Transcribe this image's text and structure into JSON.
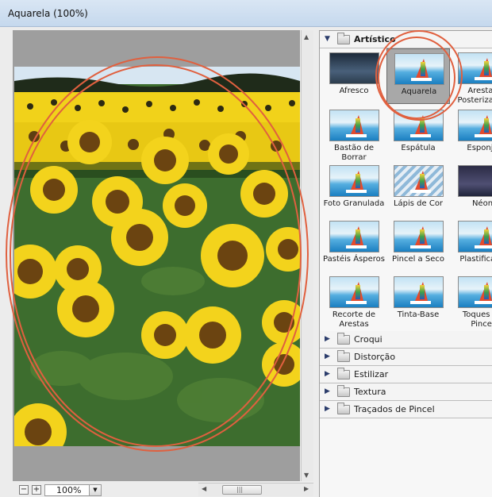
{
  "window": {
    "title": "Aquarela (100%)"
  },
  "zoom": {
    "minus": "−",
    "plus": "+",
    "value": "100%",
    "dropdown": "▼"
  },
  "scroll": {
    "up": "▲",
    "down": "▼",
    "left": "◀",
    "right": "▶",
    "grip": "|||"
  },
  "colors": {
    "annotation": "#e0603f",
    "selection": "#a8a8a8",
    "preview_bg": "#9e9e9e"
  },
  "gallery": {
    "open_category": "Artístico",
    "filters": [
      {
        "label": "Afresco",
        "style": "dark"
      },
      {
        "label": "Aquarela",
        "style": "water",
        "selected": true
      },
      {
        "label": "Arestas Posterizadas",
        "style": "water"
      },
      {
        "label": "Bastão de Borrar",
        "style": "water"
      },
      {
        "label": "Espátula",
        "style": "water"
      },
      {
        "label": "Esponja",
        "style": "water"
      },
      {
        "label": "Foto Granulada",
        "style": "water"
      },
      {
        "label": "Lápis de Cor",
        "style": "lines"
      },
      {
        "label": "Néon",
        "style": "neon"
      },
      {
        "label": "Pastéis Ásperos",
        "style": "water"
      },
      {
        "label": "Pincel a Seco",
        "style": "water"
      },
      {
        "label": "Plastificado",
        "style": "water"
      },
      {
        "label": "Recorte de Arestas",
        "style": "water"
      },
      {
        "label": "Tinta-Base",
        "style": "water"
      },
      {
        "label": "Toques de Pincel",
        "style": "water"
      }
    ],
    "categories": [
      "Croqui",
      "Distorção",
      "Estilizar",
      "Textura",
      "Traçados de Pincel"
    ]
  }
}
